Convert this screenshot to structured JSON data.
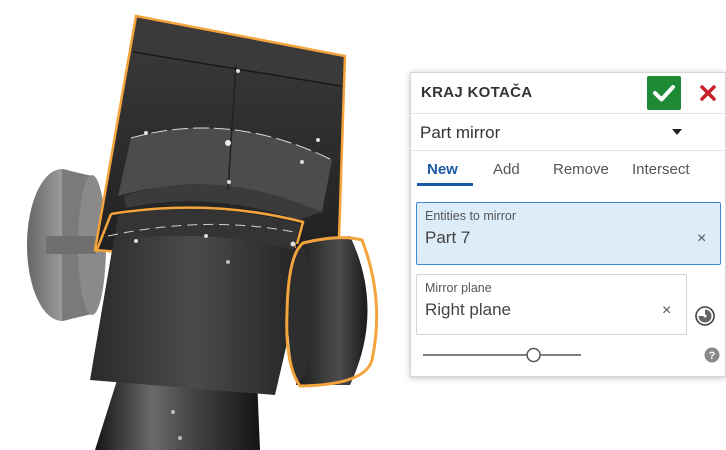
{
  "dialog": {
    "title": "KRAJ KOTAČA",
    "type_value": "Part mirror",
    "tabs": [
      {
        "label": "New",
        "active": true
      },
      {
        "label": "Add",
        "active": false
      },
      {
        "label": "Remove",
        "active": false
      },
      {
        "label": "Intersect",
        "active": false
      }
    ],
    "entities_field": {
      "label": "Entities to mirror",
      "value": "Part 7"
    },
    "plane_field": {
      "label": "Mirror plane",
      "value": "Right plane"
    },
    "clear_glyph": "×",
    "slider_level": 0.7
  },
  "colors": {
    "accent": "#1d5aa5",
    "ok": "#1e8a35",
    "cancel": "#c8202a",
    "selection": "#f3a43c",
    "active_field_bg": "#dcecf9"
  },
  "icons": [
    "check-icon",
    "close-icon",
    "dropdown-arrow-icon",
    "clear-icon",
    "clock-icon",
    "help-icon"
  ]
}
